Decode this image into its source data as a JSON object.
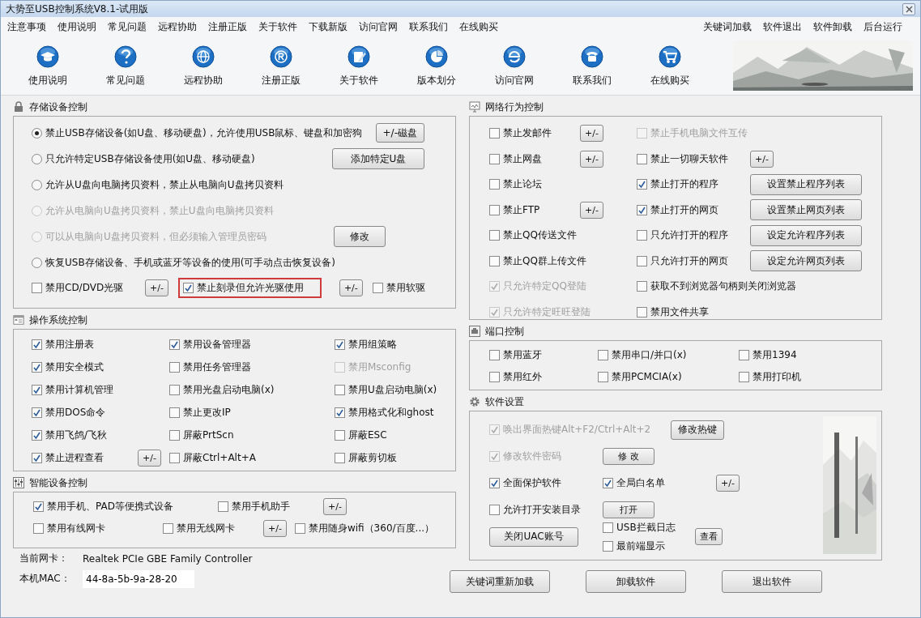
{
  "window": {
    "title": "大势至USB控制系统V8.1-试用版"
  },
  "menu_left": [
    "注意事项",
    "使用说明",
    "常见问题",
    "远程协助",
    "注册正版",
    "关于软件",
    "下载新版",
    "访问官网",
    "联系我们",
    "在线购买"
  ],
  "menu_right": [
    "关键词加载",
    "软件退出",
    "软件卸载",
    "后台运行"
  ],
  "toolbar": [
    "使用说明",
    "常见问题",
    "远程协助",
    "注册正版",
    "关于软件",
    "版本划分",
    "访问官网",
    "联系我们",
    "在线购买"
  ],
  "storage": {
    "title": "存储设备控制",
    "options": [
      {
        "label": "禁止USB存储设备(如U盘、移动硬盘)，允许使用USB鼠标、键盘和加密狗",
        "selected": true,
        "disabled": false,
        "button": "+/-磁盘"
      },
      {
        "label": "只允许特定USB存储设备使用(如U盘、移动硬盘)",
        "selected": false,
        "disabled": false,
        "button": "添加特定U盘"
      },
      {
        "label": "允许从U盘向电脑拷贝资料，禁止从电脑向U盘拷贝资料",
        "selected": false,
        "disabled": false
      },
      {
        "label": "允许从电脑向U盘拷贝资料，禁止U盘向电脑拷贝资料",
        "selected": false,
        "disabled": true
      },
      {
        "label": "可以从电脑向U盘拷贝资料，但必须输入管理员密码",
        "selected": false,
        "disabled": true,
        "button": "修改"
      },
      {
        "label": "恢复USB存储设备、手机或蓝牙等设备的使用(可手动点击恢复设备)",
        "selected": false,
        "disabled": false
      }
    ],
    "drives": [
      {
        "kind": "checkbox",
        "label": "禁用CD/DVD光驱",
        "checked": false
      },
      {
        "kind": "button",
        "label": "+/-"
      },
      {
        "kind": "checkbox",
        "label": "禁止刻录但允许光驱使用",
        "checked": true,
        "highlighted": true
      },
      {
        "kind": "button",
        "label": "+/-"
      },
      {
        "kind": "checkbox",
        "label": "禁用软驱",
        "checked": false
      }
    ]
  },
  "network": {
    "title": "网络行为控制",
    "rows": [
      {
        "left": {
          "label": "禁止发邮件",
          "checked": false,
          "disabled": false
        },
        "left_button": "+/-",
        "right": {
          "label": "禁止手机电脑文件互传",
          "checked": false,
          "disabled": true
        }
      },
      {
        "left": {
          "label": "禁止网盘",
          "checked": false,
          "disabled": false
        },
        "left_button": "+/-",
        "right": {
          "label": "禁止一切聊天软件",
          "checked": false,
          "disabled": false
        },
        "right_button": "+/-"
      },
      {
        "left": {
          "label": "禁止论坛",
          "checked": false,
          "disabled": false
        },
        "right": {
          "label": "禁止打开的程序",
          "checked": true,
          "disabled": false
        },
        "right_button": "设置禁止程序列表"
      },
      {
        "left": {
          "label": "禁止FTP",
          "checked": false,
          "disabled": false
        },
        "left_button": "+/-",
        "right": {
          "label": "禁止打开的网页",
          "checked": true,
          "disabled": false
        },
        "right_button": "设置禁止网页列表"
      },
      {
        "left": {
          "label": "禁止QQ传送文件",
          "checked": false,
          "disabled": false
        },
        "right": {
          "label": "只允许打开的程序",
          "checked": false,
          "disabled": false
        },
        "right_button": "设定允许程序列表"
      },
      {
        "left": {
          "label": "禁止QQ群上传文件",
          "checked": false,
          "disabled": false
        },
        "right": {
          "label": "只允许打开的网页",
          "checked": false,
          "disabled": false
        },
        "right_button": "设定允许网页列表"
      },
      {
        "left": {
          "label": "只允许特定QQ登陆",
          "checked": true,
          "disabled": true
        },
        "right": {
          "label": "获取不到浏览器句柄则关闭浏览器",
          "checked": false,
          "disabled": false
        }
      },
      {
        "left": {
          "label": "只允许特定旺旺登陆",
          "checked": true,
          "disabled": true
        },
        "right": {
          "label": "禁用文件共享",
          "checked": false,
          "disabled": false
        }
      }
    ]
  },
  "os": {
    "title": "操作系统控制",
    "items": [
      {
        "label": "禁用注册表",
        "checked": true,
        "disabled": false
      },
      {
        "label": "禁用设备管理器",
        "checked": true,
        "disabled": false
      },
      {
        "label": "禁用组策略",
        "checked": true,
        "disabled": false
      },
      {
        "label": "禁用安全模式",
        "checked": true,
        "disabled": false
      },
      {
        "label": "禁用任务管理器",
        "checked": false,
        "disabled": false
      },
      {
        "label": "禁用Msconfig",
        "checked": false,
        "disabled": true
      },
      {
        "label": "禁用计算机管理",
        "checked": true,
        "disabled": false
      },
      {
        "label": "禁用光盘启动电脑(x)",
        "checked": false,
        "disabled": false
      },
      {
        "label": "禁用U盘启动电脑(x)",
        "checked": false,
        "disabled": false
      },
      {
        "label": "禁用DOS命令",
        "checked": true,
        "disabled": false
      },
      {
        "label": "禁止更改IP",
        "checked": false,
        "disabled": false
      },
      {
        "label": "禁用格式化和ghost",
        "checked": true,
        "disabled": false
      },
      {
        "label": "禁用飞鸽/飞秋",
        "checked": true,
        "disabled": false
      },
      {
        "label": "屏蔽PrtScn",
        "checked": false,
        "disabled": false
      },
      {
        "label": "屏蔽ESC",
        "checked": false,
        "disabled": false
      },
      {
        "label": "禁止进程查看",
        "checked": true,
        "disabled": false,
        "button": "+/-"
      },
      {
        "label": "屏蔽Ctrl+Alt+A",
        "checked": false,
        "disabled": false
      },
      {
        "label": "屏蔽剪切板",
        "checked": false,
        "disabled": false
      }
    ]
  },
  "ports": {
    "title": "端口控制",
    "items": [
      {
        "label": "禁用蓝牙",
        "checked": false
      },
      {
        "label": "禁用串口/并口(x)",
        "checked": false
      },
      {
        "label": "禁用1394",
        "checked": false
      },
      {
        "label": "禁用红外",
        "checked": false
      },
      {
        "label": "禁用PCMCIA(x)",
        "checked": false
      },
      {
        "label": "禁用打印机",
        "checked": false
      }
    ]
  },
  "smart": {
    "title": "智能设备控制",
    "controls": [
      {
        "kind": "checkbox",
        "label": "禁用手机、PAD等便携式设备",
        "checked": true
      },
      {
        "kind": "checkbox",
        "label": "禁用手机助手",
        "checked": false
      },
      {
        "kind": "button",
        "label": "+/-"
      },
      {
        "kind": "checkbox",
        "label": "禁用有线网卡",
        "checked": false
      },
      {
        "kind": "checkbox",
        "label": "禁用无线网卡",
        "checked": false
      },
      {
        "kind": "button",
        "label": "+/-"
      },
      {
        "kind": "checkbox",
        "label": "禁用随身wifi（360/百度...）",
        "checked": false
      }
    ]
  },
  "software": {
    "title": "软件设置",
    "rows": [
      [
        {
          "kind": "checkbox",
          "label": "唤出界面热键Alt+F2/Ctrl+Alt+2",
          "checked": true,
          "disabled": true
        },
        {
          "kind": "button",
          "label": "修改热键"
        }
      ],
      [
        {
          "kind": "checkbox",
          "label": "修改软件密码",
          "checked": true,
          "disabled": true
        },
        {
          "kind": "button",
          "label": "修 改"
        }
      ],
      [
        {
          "kind": "checkbox",
          "label": "全面保护软件",
          "checked": true,
          "disabled": false
        },
        {
          "kind": "checkbox",
          "label": "全局白名单",
          "checked": true,
          "disabled": false
        },
        {
          "kind": "button",
          "label": "+/-"
        }
      ],
      [
        {
          "kind": "checkbox",
          "label": "允许打开安装目录",
          "checked": false,
          "disabled": false
        },
        {
          "kind": "button",
          "label": "打开"
        }
      ],
      [
        {
          "kind": "button",
          "label": "关闭UAC账号"
        },
        {
          "kind": "stack",
          "items": [
            {
              "label": "USB拦截日志",
              "checked": false,
              "disabled": false
            },
            {
              "label": "最前端显示",
              "checked": false,
              "disabled": false
            }
          ]
        },
        {
          "kind": "button",
          "label": "查看"
        }
      ]
    ]
  },
  "info": [
    {
      "label": "当前网卡：",
      "value": "Realtek PCIe GBE Family Controller",
      "kind": "text"
    },
    {
      "label": "本机MAC：",
      "value": "44-8a-5b-9a-28-20",
      "kind": "field"
    }
  ],
  "bottom_buttons": [
    "关键词重新加载",
    "卸载软件",
    "退出软件"
  ]
}
